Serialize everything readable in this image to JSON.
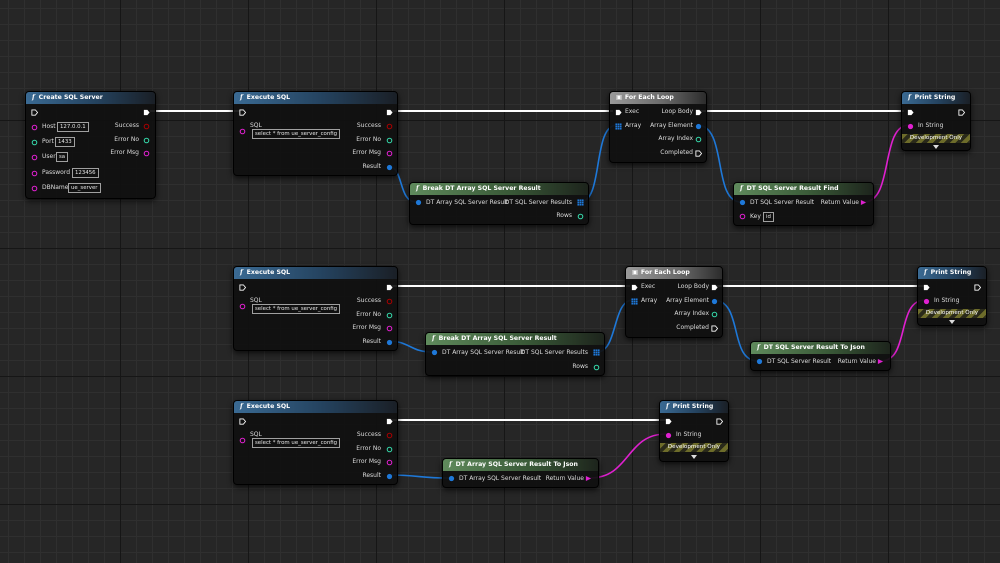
{
  "colors": {
    "exec": "#ffffff",
    "string": "#e020d0",
    "struct": "#1e78d8",
    "bool": "#a60000",
    "int": "#35d7a9",
    "array_pin": "#1e78d8"
  },
  "nodes": {
    "create": {
      "title": "Create SQL Server",
      "pins": {
        "host": "Host",
        "host_val": "127.0.0.1",
        "port": "Port",
        "port_val": "1433",
        "user": "User",
        "user_val": "sa",
        "password": "Password",
        "password_val": "123456",
        "dbname": "DBName",
        "dbname_val": "ue_server",
        "success": "Success",
        "error_no": "Error No",
        "error_msg": "Error Msg"
      }
    },
    "exec1": {
      "title": "Execute SQL",
      "sql": "SQL",
      "sql_val": "select * from  ue_server_config",
      "success": "Success",
      "error_no": "Error No",
      "error_msg": "Error Msg",
      "result": "Result"
    },
    "break1": {
      "title": "Break DT Array SQL Server Result",
      "in": "DT Array SQL Server Result",
      "out": "DT SQL Server Results",
      "rows": "Rows"
    },
    "foreach1": {
      "title": "For Each Loop",
      "exec": "Exec",
      "array": "Array",
      "loop_body": "Loop Body",
      "array_element": "Array Element",
      "array_index": "Array Index",
      "completed": "Completed"
    },
    "find1": {
      "title": "DT SQL Server Result Find",
      "in": "DT SQL Server Result",
      "key": "Key",
      "key_val": "id",
      "ret": "Return Value"
    },
    "print1": {
      "title": "Print String",
      "in": "In String",
      "dev": "Development Only"
    },
    "exec2": {
      "title": "Execute SQL",
      "sql": "SQL",
      "sql_val": "select * from  ue_server_config",
      "success": "Success",
      "error_no": "Error No",
      "error_msg": "Error Msg",
      "result": "Result"
    },
    "break2": {
      "title": "Break DT Array SQL Server Result",
      "in": "DT Array SQL Server Result",
      "out": "DT SQL Server Results",
      "rows": "Rows"
    },
    "foreach2": {
      "title": "For Each Loop",
      "exec": "Exec",
      "array": "Array",
      "loop_body": "Loop Body",
      "array_element": "Array Element",
      "array_index": "Array Index",
      "completed": "Completed"
    },
    "tojson1": {
      "title": "DT SQL Server Result To Json",
      "in": "DT SQL Server Result",
      "ret": "Return Value"
    },
    "print2": {
      "title": "Print String",
      "in": "In String",
      "dev": "Development Only"
    },
    "exec3": {
      "title": "Execute SQL",
      "sql": "SQL",
      "sql_val": "select * from  ue_server_config",
      "success": "Success",
      "error_no": "Error No",
      "error_msg": "Error Msg",
      "result": "Result"
    },
    "tojson2": {
      "title": "DT Array SQL Server Result To Json",
      "in": "DT Array SQL Server Result",
      "ret": "Return Value"
    },
    "print3": {
      "title": "Print String",
      "in": "In String",
      "dev": "Development Only"
    }
  }
}
